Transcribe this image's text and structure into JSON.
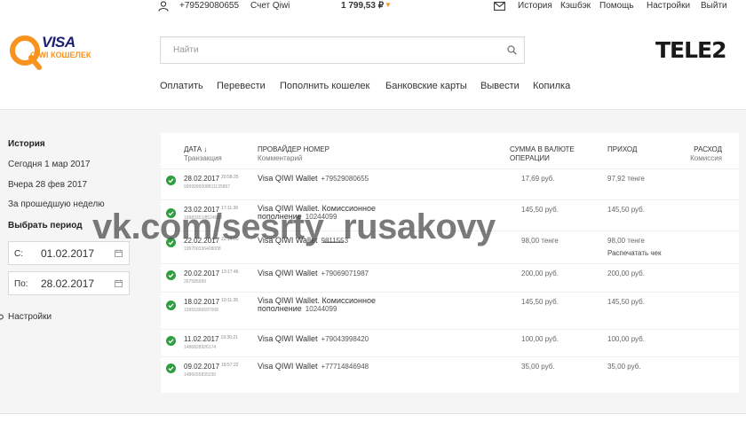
{
  "topbar": {
    "phone": "+79529080655",
    "account_label": "Счет Qiwi",
    "balance": "1 799,53 ₽",
    "links": [
      "История",
      "Кэшбэк",
      "Помощь",
      "Настройки",
      "Выйти"
    ]
  },
  "logo": {
    "visa": "VISA",
    "sub": "QIWI КОШЕЛЕК"
  },
  "search": {
    "placeholder": "Найти"
  },
  "partner": "TELE2",
  "mainnav": [
    "Оплатить",
    "Перевести",
    "Пополнить кошелек",
    "Банковские карты",
    "Вывести",
    "Копилка"
  ],
  "sidebar": {
    "title": "История",
    "quick": [
      "Сегодня 1 мар 2017",
      "Вчера 28 фев 2017",
      "За прошедшую неделю"
    ],
    "period_title": "Выбрать период",
    "from_label": "С:",
    "from_value": "01.02.2017",
    "to_label": "По:",
    "to_value": "28.02.2017",
    "settings": "Настройки"
  },
  "table": {
    "headers": {
      "date": "ДАТА ↓",
      "date_sub": "Транзакция",
      "provider": "ПРОВАЙДЕР НОМЕР",
      "provider_sub": "Комментарий",
      "amount": "СУММА В ВАЛЮТЕ",
      "amount2": "ОПЕРАЦИИ",
      "income": "ПРИХОД",
      "expense": "РАСХОД",
      "expense_sub": "Комиссия"
    },
    "rows": [
      {
        "date": "28.02.2017",
        "time": "20:58:25",
        "txid": "9999999008811135867",
        "provider": "Visa QIWI Wallet",
        "number": "+79529080655",
        "amount": "17,69 руб.",
        "income": "97,92 тенге",
        "extra": ""
      },
      {
        "date": "23.02.2017",
        "time": "17:11:36",
        "txid": "19983352/8524008",
        "provider": "Visa QIWI Wallet. Комиссионное пополнение",
        "number": "10244099",
        "amount": "145,50 руб.",
        "income": "145,50 руб.",
        "extra": ""
      },
      {
        "date": "22.02.2017",
        "time": "22:14:00",
        "txid": "199700336408008",
        "provider": "Visa QIWI Wallet",
        "number": "9811553",
        "amount": "98,00 тенге",
        "income": "98,00 тенге",
        "extra": "Распечатать чек"
      },
      {
        "date": "20.02.2017",
        "time": "13:17:46",
        "txid": "267585999",
        "provider": "Visa QIWI Wallet",
        "number": "+79069071987",
        "amount": "200,00 руб.",
        "income": "200,00 руб.",
        "extra": ""
      },
      {
        "date": "18.02.2017",
        "time": "10:11:35",
        "txid": "19955366597008",
        "provider": "Visa QIWI Wallet. Комиссионное пополнение",
        "number": "10244099",
        "amount": "145,50 руб.",
        "income": "145,50 руб.",
        "extra": ""
      },
      {
        "date": "11.02.2017",
        "time": "19:30:21",
        "txid": "1486828926174",
        "provider": "Visa QIWI Wallet",
        "number": "+79043998420",
        "amount": "100,00 руб.",
        "income": "100,00 руб.",
        "extra": ""
      },
      {
        "date": "09.02.2017",
        "time": "18:57:22",
        "txid": "1486655835330",
        "provider": "Visa QIWI Wallet",
        "number": "+77714846948",
        "amount": "35,00 руб.",
        "income": "35,00 руб.",
        "extra": ""
      }
    ]
  },
  "watermark": "vk.com/sesrty_rusakovy",
  "colors": {
    "accent": "#f7931e",
    "ok": "#2e9e3e",
    "visa": "#1a1f71"
  }
}
